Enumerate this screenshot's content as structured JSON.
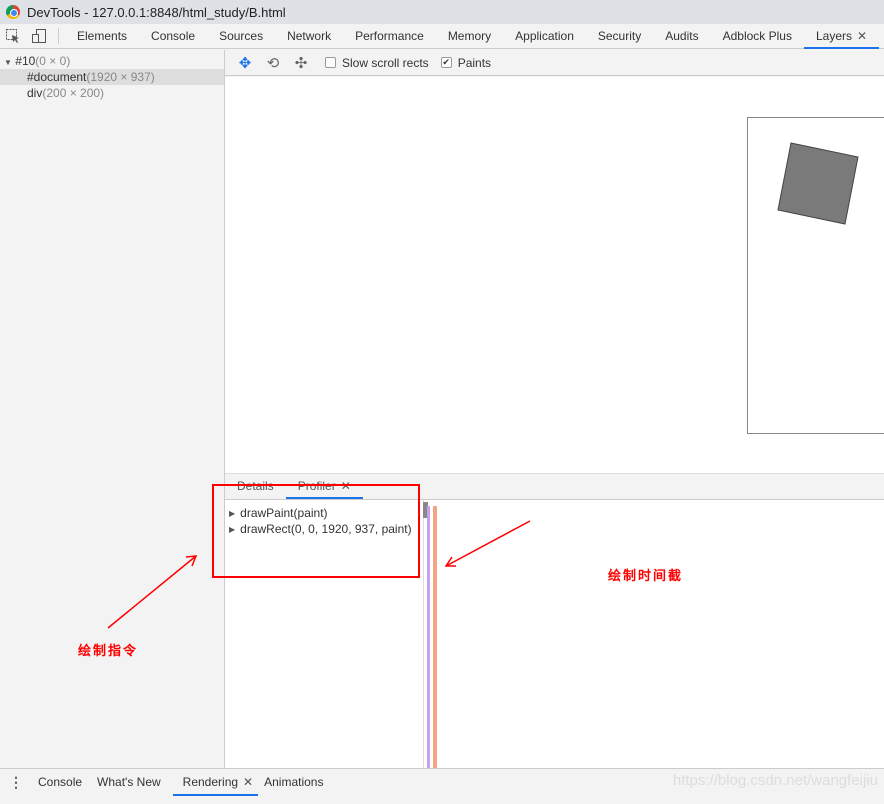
{
  "window": {
    "title": "DevTools - 127.0.0.1:8848/html_study/B.html"
  },
  "tabs": [
    {
      "label": "Elements"
    },
    {
      "label": "Console"
    },
    {
      "label": "Sources"
    },
    {
      "label": "Network"
    },
    {
      "label": "Performance"
    },
    {
      "label": "Memory"
    },
    {
      "label": "Application"
    },
    {
      "label": "Security"
    },
    {
      "label": "Audits"
    },
    {
      "label": "Adblock Plus"
    },
    {
      "label": "Layers",
      "active": true
    }
  ],
  "close_glyph": "✕",
  "layer_tree": [
    {
      "name": "#10",
      "size": "(0 × 0)"
    },
    {
      "name": "#document",
      "size": "(1920 × 937)",
      "selected": true
    },
    {
      "name": "div",
      "size": "(200 × 200)"
    }
  ],
  "toolbar": {
    "slow_scroll_rects": {
      "label": "Slow scroll rects",
      "checked": false
    },
    "paints": {
      "label": "Paints",
      "checked": true
    }
  },
  "subtabs": [
    {
      "label": "Details"
    },
    {
      "label": "Profiler",
      "active": true
    }
  ],
  "profiler": {
    "commands": [
      "drawPaint(paint)",
      "drawRect(0, 0, 1920, 937, paint)"
    ]
  },
  "drawer": {
    "tabs": [
      {
        "label": "Console"
      },
      {
        "label": "What's New"
      },
      {
        "label": "Rendering",
        "active": true
      },
      {
        "label": "Animations"
      }
    ]
  },
  "annotations": {
    "commands": "绘制指令",
    "timeline": "绘制时间截"
  },
  "watermark": "https://blog.csdn.net/wangfeijiu",
  "colors": {
    "accent": "#1a73e8",
    "annotation": "#ff0000",
    "bar_purple": "#c9a0f0",
    "bar_orange": "#f5a585"
  }
}
